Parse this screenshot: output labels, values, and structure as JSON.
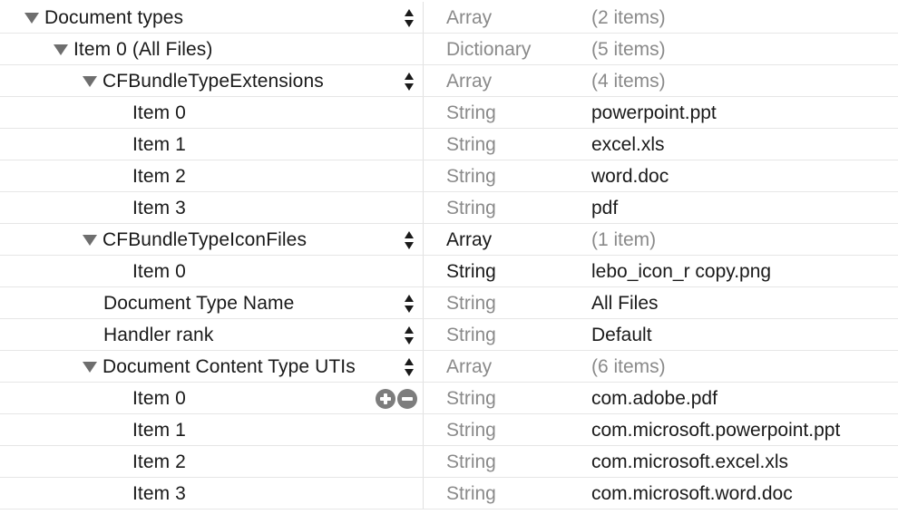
{
  "rows": [
    {
      "key": "Document types",
      "depth": 0,
      "disclosure": true,
      "stepper": true,
      "type": "Array",
      "type_strong": false,
      "value": "(2 items)",
      "value_is_count": true,
      "row_actions": false
    },
    {
      "key": "Item 0 (All Files)",
      "depth": 1,
      "disclosure": true,
      "stepper": false,
      "type": "Dictionary",
      "type_strong": false,
      "value": "(5 items)",
      "value_is_count": true,
      "row_actions": false
    },
    {
      "key": "CFBundleTypeExtensions",
      "depth": 2,
      "disclosure": true,
      "stepper": true,
      "type": "Array",
      "type_strong": false,
      "value": "(4 items)",
      "value_is_count": true,
      "row_actions": false
    },
    {
      "key": "Item 0",
      "depth": 3,
      "disclosure": false,
      "stepper": false,
      "type": "String",
      "type_strong": false,
      "value": "powerpoint.ppt",
      "value_is_count": false,
      "row_actions": false
    },
    {
      "key": "Item 1",
      "depth": 3,
      "disclosure": false,
      "stepper": false,
      "type": "String",
      "type_strong": false,
      "value": "excel.xls",
      "value_is_count": false,
      "row_actions": false
    },
    {
      "key": "Item 2",
      "depth": 3,
      "disclosure": false,
      "stepper": false,
      "type": "String",
      "type_strong": false,
      "value": "word.doc",
      "value_is_count": false,
      "row_actions": false
    },
    {
      "key": "Item 3",
      "depth": 3,
      "disclosure": false,
      "stepper": false,
      "type": "String",
      "type_strong": false,
      "value": "pdf",
      "value_is_count": false,
      "row_actions": false
    },
    {
      "key": "CFBundleTypeIconFiles",
      "depth": 2,
      "disclosure": true,
      "stepper": true,
      "type": "Array",
      "type_strong": true,
      "value": "(1 item)",
      "value_is_count": true,
      "row_actions": false
    },
    {
      "key": "Item 0",
      "depth": 3,
      "disclosure": false,
      "stepper": false,
      "type": "String",
      "type_strong": true,
      "value": "lebo_icon_r copy.png",
      "value_is_count": false,
      "row_actions": false
    },
    {
      "key": "Document Type Name",
      "depth": 2,
      "disclosure": false,
      "stepper": true,
      "type": "String",
      "type_strong": false,
      "value": "All Files",
      "value_is_count": false,
      "row_actions": false
    },
    {
      "key": "Handler rank",
      "depth": 2,
      "disclosure": false,
      "stepper": true,
      "type": "String",
      "type_strong": false,
      "value": "Default",
      "value_is_count": false,
      "row_actions": false
    },
    {
      "key": "Document Content Type UTIs",
      "depth": 2,
      "disclosure": true,
      "stepper": true,
      "type": "Array",
      "type_strong": false,
      "value": "(6 items)",
      "value_is_count": true,
      "row_actions": false
    },
    {
      "key": "Item 0",
      "depth": 3,
      "disclosure": false,
      "stepper": false,
      "type": "String",
      "type_strong": false,
      "value": "com.adobe.pdf",
      "value_is_count": false,
      "row_actions": true
    },
    {
      "key": "Item 1",
      "depth": 3,
      "disclosure": false,
      "stepper": false,
      "type": "String",
      "type_strong": false,
      "value": "com.microsoft.powerpoint.ppt",
      "value_is_count": false,
      "row_actions": false
    },
    {
      "key": "Item 2",
      "depth": 3,
      "disclosure": false,
      "stepper": false,
      "type": "String",
      "type_strong": false,
      "value": "com.microsoft.excel.xls",
      "value_is_count": false,
      "row_actions": false
    },
    {
      "key": "Item 3",
      "depth": 3,
      "disclosure": false,
      "stepper": false,
      "type": "String",
      "type_strong": false,
      "value": "com.microsoft.word.doc",
      "value_is_count": false,
      "row_actions": false
    }
  ],
  "icons": {
    "disclosure": "disclosure-triangle-down-icon",
    "stepper": "up-down-stepper-icon",
    "add": "plus-circle-icon",
    "remove": "minus-circle-icon"
  },
  "colors": {
    "dimmed_text": "#8a8a8a",
    "text": "#1a1a1a",
    "icon_gray": "#6e6e6e"
  }
}
